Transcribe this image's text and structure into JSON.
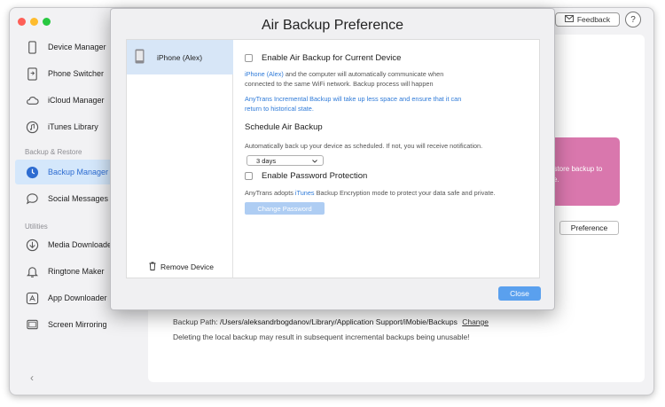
{
  "sidebar": {
    "items": [
      {
        "label": "Device Manager",
        "icon": "phone-outline-icon"
      },
      {
        "label": "Phone Switcher",
        "icon": "phone-switch-icon"
      },
      {
        "label": "iCloud Manager",
        "icon": "cloud-icon"
      },
      {
        "label": "iTunes Library",
        "icon": "music-note-icon"
      }
    ],
    "section_backup": "Backup & Restore",
    "backup_items": [
      {
        "label": "Backup Manager",
        "icon": "backup-clock-icon"
      },
      {
        "label": "Social Messages Ma",
        "icon": "chat-bubble-icon"
      }
    ],
    "section_utilities": "Utilities",
    "utility_items": [
      {
        "label": "Media Downloader",
        "icon": "download-icon"
      },
      {
        "label": "Ringtone Maker",
        "icon": "bell-icon"
      },
      {
        "label": "App Downloader",
        "icon": "app-store-icon"
      },
      {
        "label": "Screen Mirroring",
        "icon": "screen-icon"
      }
    ],
    "back_glyph": "‹"
  },
  "toolbar": {
    "feedback_label": "Feedback",
    "help_glyph": "?"
  },
  "main": {
    "promo_text_line1": "estore backup to",
    "promo_text_line2": "ce.",
    "preference_label": "Preference",
    "backup_path_label": "Backup Path:",
    "backup_path_value": "/Users/aleksandrbogdanov/Library/Application Support/iMobie/Backups",
    "change_link": "Change",
    "warning": "Deleting the local backup may result in subsequent incremental backups being unusable!"
  },
  "dialog": {
    "title": "Air Backup Preference",
    "device_name": "iPhone (Alex)",
    "remove_device_label": "Remove Device",
    "enable_air_backup": "Enable Air Backup for Current Device",
    "desc1_blue": "iPhone (Alex)",
    "desc1_rest": " and the computer will automatically communicate when",
    "desc1_line2": "connected to the same WiFi network. Backup process will happen",
    "desc2_line1": "AnyTrans Incremental Backup will take up less space and ensure that it can",
    "desc2_line2": "return to historical state.",
    "schedule_title": "Schedule Air Backup",
    "schedule_desc": "Automatically back up your device as scheduled. If not, you will receive notification.",
    "schedule_value": "3 days",
    "enable_password": "Enable Password Protection",
    "pw_desc_a": "AnyTrans adopts ",
    "pw_desc_blue": "iTunes",
    "pw_desc_b": " Backup Encryption mode to protect your data safe and private.",
    "change_password_label": "Change Password",
    "close_label": "Close"
  },
  "colors": {
    "accent": "#2e7ad8",
    "active_nav_bg": "#d4e7fb",
    "promo": "#d977ad",
    "close_button": "#5aa0ee"
  }
}
